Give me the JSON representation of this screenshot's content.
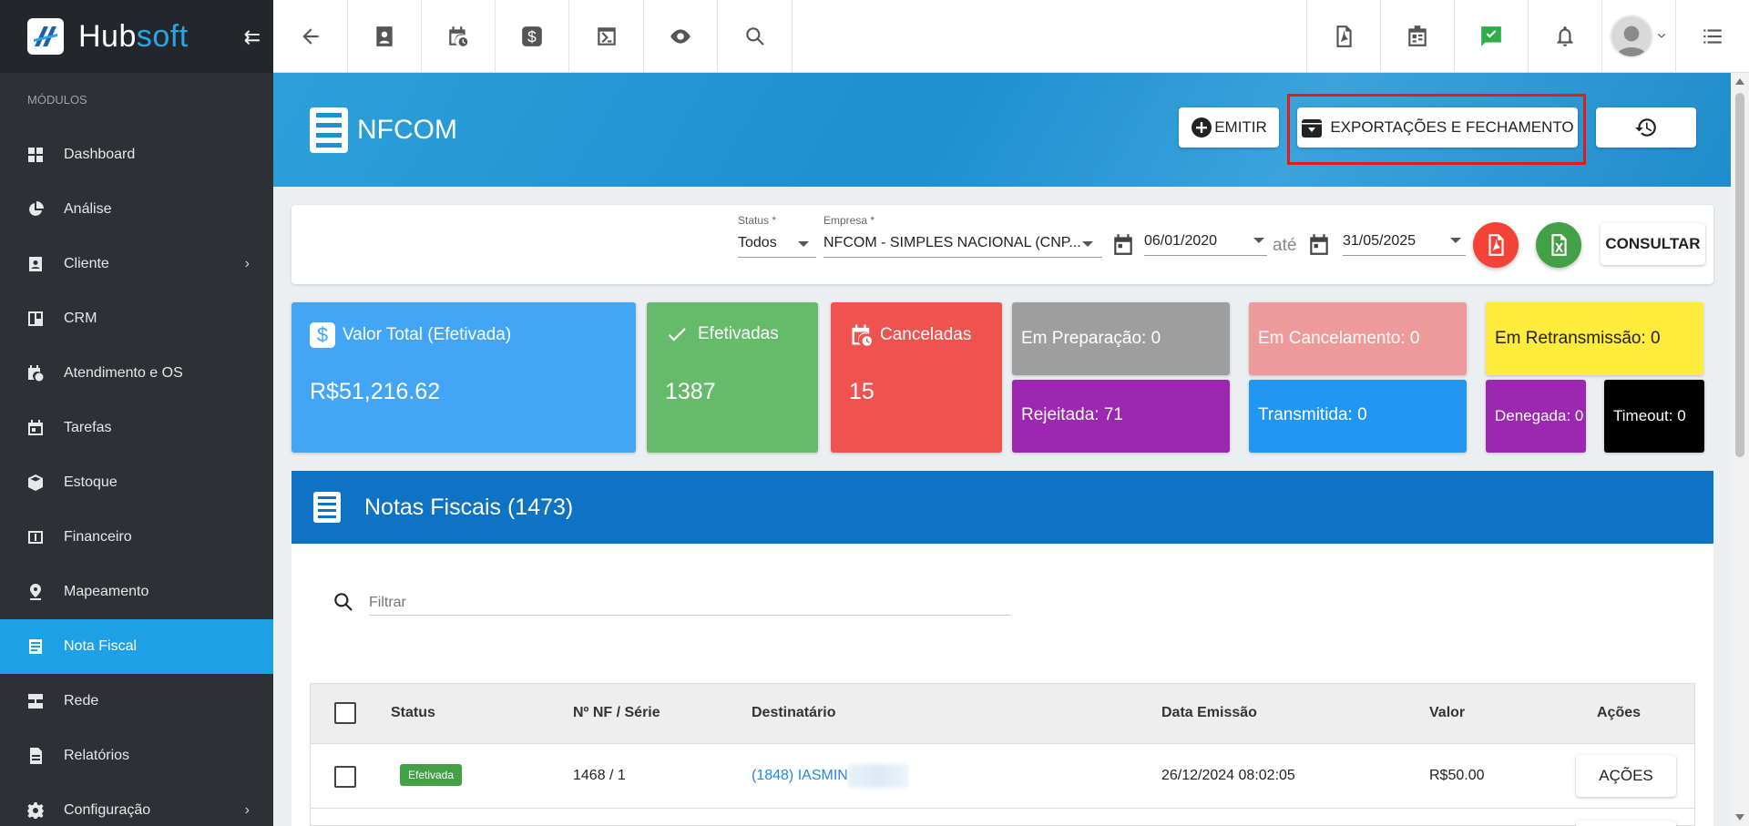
{
  "app": {
    "brand_part1": "Hub",
    "brand_part2": "soft",
    "collapse_glyph": "⇇"
  },
  "sidebar": {
    "section_label": "MÓDULOS",
    "items": [
      {
        "label": "Dashboard",
        "icon": "dashboard-icon",
        "has_submenu": false,
        "active": false
      },
      {
        "label": "Análise",
        "icon": "pie-chart-icon",
        "has_submenu": false,
        "active": false
      },
      {
        "label": "Cliente",
        "icon": "contact-icon",
        "has_submenu": true,
        "active": false
      },
      {
        "label": "CRM",
        "icon": "board-icon",
        "has_submenu": false,
        "active": false
      },
      {
        "label": "Atendimento e OS",
        "icon": "calendar-clock-icon",
        "has_submenu": false,
        "active": false
      },
      {
        "label": "Tarefas",
        "icon": "tasks-icon",
        "has_submenu": false,
        "active": false
      },
      {
        "label": "Estoque",
        "icon": "box-icon",
        "has_submenu": false,
        "active": false
      },
      {
        "label": "Financeiro",
        "icon": "money-icon",
        "has_submenu": false,
        "active": false
      },
      {
        "label": "Mapeamento",
        "icon": "map-pin-icon",
        "has_submenu": false,
        "active": false
      },
      {
        "label": "Nota Fiscal",
        "icon": "receipt-icon",
        "has_submenu": false,
        "active": true
      },
      {
        "label": "Rede",
        "icon": "server-icon",
        "has_submenu": false,
        "active": false
      },
      {
        "label": "Relatórios",
        "icon": "report-icon",
        "has_submenu": false,
        "active": false
      },
      {
        "label": "Configuração",
        "icon": "gear-icon",
        "has_submenu": true,
        "active": false
      }
    ],
    "chevron": "›"
  },
  "page": {
    "title": "NFCOM"
  },
  "header_buttons": {
    "emitir": "EMITIR",
    "exportacoes": "EXPORTAÇÕES E FECHAMENTO"
  },
  "filters": {
    "status_label": "Status *",
    "status_value": "Todos",
    "empresa_label": "Empresa *",
    "empresa_value": "NFCOM - SIMPLES NACIONAL (CNP...",
    "date_from": "06/01/2020",
    "ate_label": "até",
    "date_to": "31/05/2025",
    "consultar": "CONSULTAR"
  },
  "stats": {
    "valor_total_label": "Valor Total (Efetivada)",
    "valor_total_value": "R$51,216.62",
    "efetivadas_label": "Efetivadas",
    "efetivadas_value": "1387",
    "canceladas_label": "Canceladas",
    "canceladas_value": "15",
    "em_preparacao": "Em Preparação: 0",
    "rejeitada": "Rejeitada: 71",
    "em_cancelamento": "Em Cancelamento: 0",
    "transmitida": "Transmitida: 0",
    "em_retransmissao": "Em Retransmissão: 0",
    "denegada": "Denegada: 0",
    "timeout": "Timeout: 0"
  },
  "colors": {
    "sidebar_bg": "#2d3035",
    "active_nav": "#1ea0e6",
    "blue_card": "#42a5f5",
    "green_card": "#66bb6a",
    "red_card": "#ef5350",
    "purple_card": "#9c27b0",
    "yellow_card": "#ffeb3b",
    "section_header": "#0f73c5"
  },
  "notas": {
    "title": "Notas Fiscais (1473)",
    "filter_placeholder": "Filtrar",
    "columns": [
      "Status",
      "Nº NF / Série",
      "Destinatário",
      "Data Emissão",
      "Valor",
      "Ações"
    ],
    "rows": [
      {
        "status": "Efetivada",
        "nf_serie": "1468 / 1",
        "destinatario": "(1848) IASMIN",
        "data_emissao": "26/12/2024 08:02:05",
        "valor": "R$50.00",
        "acoes": "AÇÕES"
      }
    ]
  }
}
